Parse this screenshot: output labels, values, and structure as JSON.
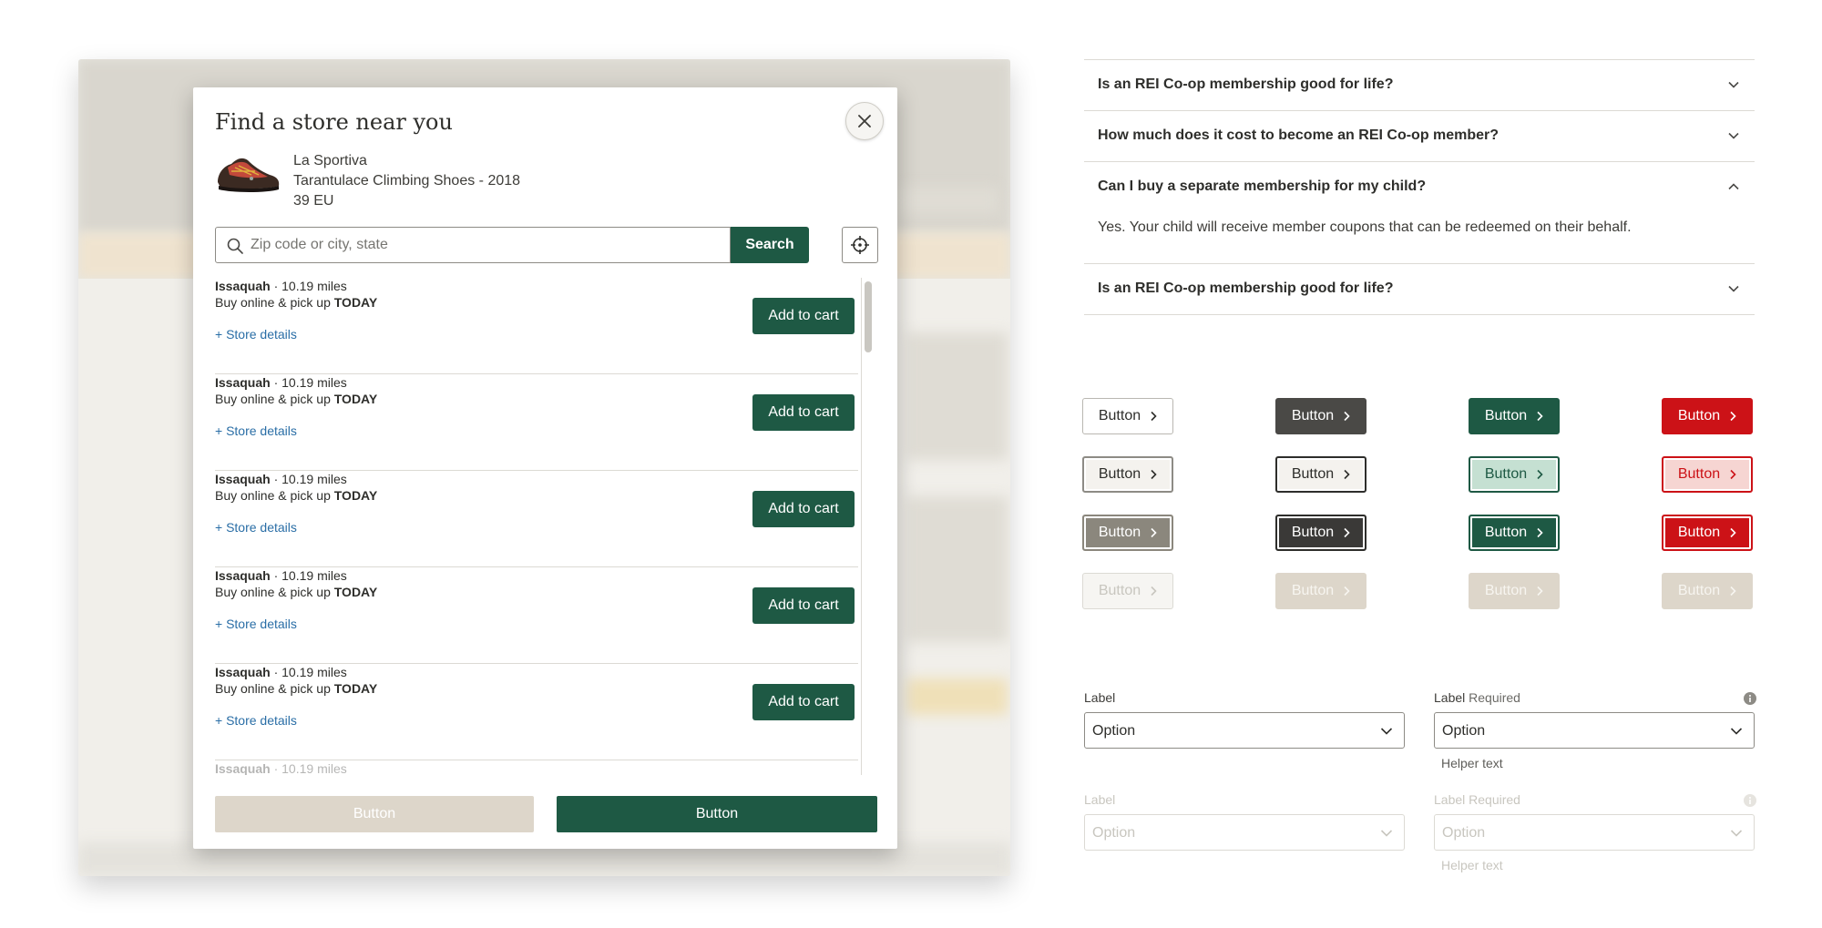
{
  "modal": {
    "title": "Find a store near you",
    "product": {
      "brand": "La Sportiva",
      "name": "Tarantulace Climbing Shoes - 2018",
      "size": "39 EU",
      "image_icon": "climbing-shoe-icon"
    },
    "search": {
      "placeholder": "Zip code or city, state",
      "value": "",
      "button_label": "Search"
    },
    "stores": [
      {
        "name": "Issaquah",
        "distance": " · 10.19 miles",
        "pickup_prefix": "Buy online & pick up ",
        "pickup_day": "TODAY",
        "details_label": "+ Store details",
        "button_label": "Add to cart"
      },
      {
        "name": "Issaquah",
        "distance": " · 10.19 miles",
        "pickup_prefix": "Buy online & pick up ",
        "pickup_day": "TODAY",
        "details_label": "+ Store details",
        "button_label": "Add to cart"
      },
      {
        "name": "Issaquah",
        "distance": " · 10.19 miles",
        "pickup_prefix": "Buy online & pick up ",
        "pickup_day": "TODAY",
        "details_label": "+ Store details",
        "button_label": "Add to cart"
      },
      {
        "name": "Issaquah",
        "distance": " · 10.19 miles",
        "pickup_prefix": "Buy online & pick up ",
        "pickup_day": "TODAY",
        "details_label": "+ Store details",
        "button_label": "Add to cart"
      },
      {
        "name": "Issaquah",
        "distance": " · 10.19 miles",
        "pickup_prefix": "Buy online & pick up ",
        "pickup_day": "TODAY",
        "details_label": "+ Store details",
        "button_label": "Add to cart"
      },
      {
        "name": "Issaquah",
        "distance": " · 10.19 miles",
        "pickup_prefix": "",
        "pickup_day": "",
        "details_label": "",
        "button_label": ""
      }
    ],
    "footer": {
      "secondary_label": "Button",
      "primary_label": "Button"
    }
  },
  "faq": {
    "items": [
      {
        "question": "Is an REI Co-op membership good for life?",
        "expanded": false,
        "answer": ""
      },
      {
        "question": "How much does it cost to become an REI Co-op member?",
        "expanded": false,
        "answer": ""
      },
      {
        "question": "Can I buy a separate membership for my child?",
        "expanded": true,
        "answer": "Yes. Your child will receive member coupons that can be redeemed on their behalf."
      },
      {
        "question": "Is an REI Co-op membership good for life?",
        "expanded": false,
        "answer": ""
      }
    ]
  },
  "button_grid": {
    "label": "Button",
    "variants": [
      "secondary",
      "tertiary",
      "primary",
      "danger"
    ],
    "states": [
      "default",
      "hover",
      "active",
      "disabled"
    ]
  },
  "selects": [
    {
      "label": "Label",
      "required_text": "",
      "value": "Option",
      "helper": "",
      "info_icon": false,
      "disabled": false
    },
    {
      "label": "Label",
      "required_text": " Required",
      "value": "Option",
      "helper": "Helper text",
      "info_icon": true,
      "disabled": false
    },
    {
      "label": "Label",
      "required_text": "",
      "value": "Option",
      "helper": "",
      "info_icon": false,
      "disabled": true
    },
    {
      "label": "Label",
      "required_text": " Required",
      "value": "Option",
      "helper": "Helper text",
      "info_icon": true,
      "disabled": true
    }
  ],
  "colors": {
    "primary_green": "#1e5944",
    "tertiary_dark": "#4a4946",
    "danger_red": "#cc1217",
    "disabled_beige": "#ddd6ca",
    "link_blue": "#2a6ea6",
    "text_dark": "#2e2e2b"
  },
  "icons": {
    "close": "close-icon",
    "search": "search-icon",
    "locate": "crosshair-icon",
    "chevron_right": "chevron-right-icon",
    "chevron_down": "chevron-down-icon",
    "chevron_up": "chevron-up-icon",
    "info": "info-icon"
  }
}
